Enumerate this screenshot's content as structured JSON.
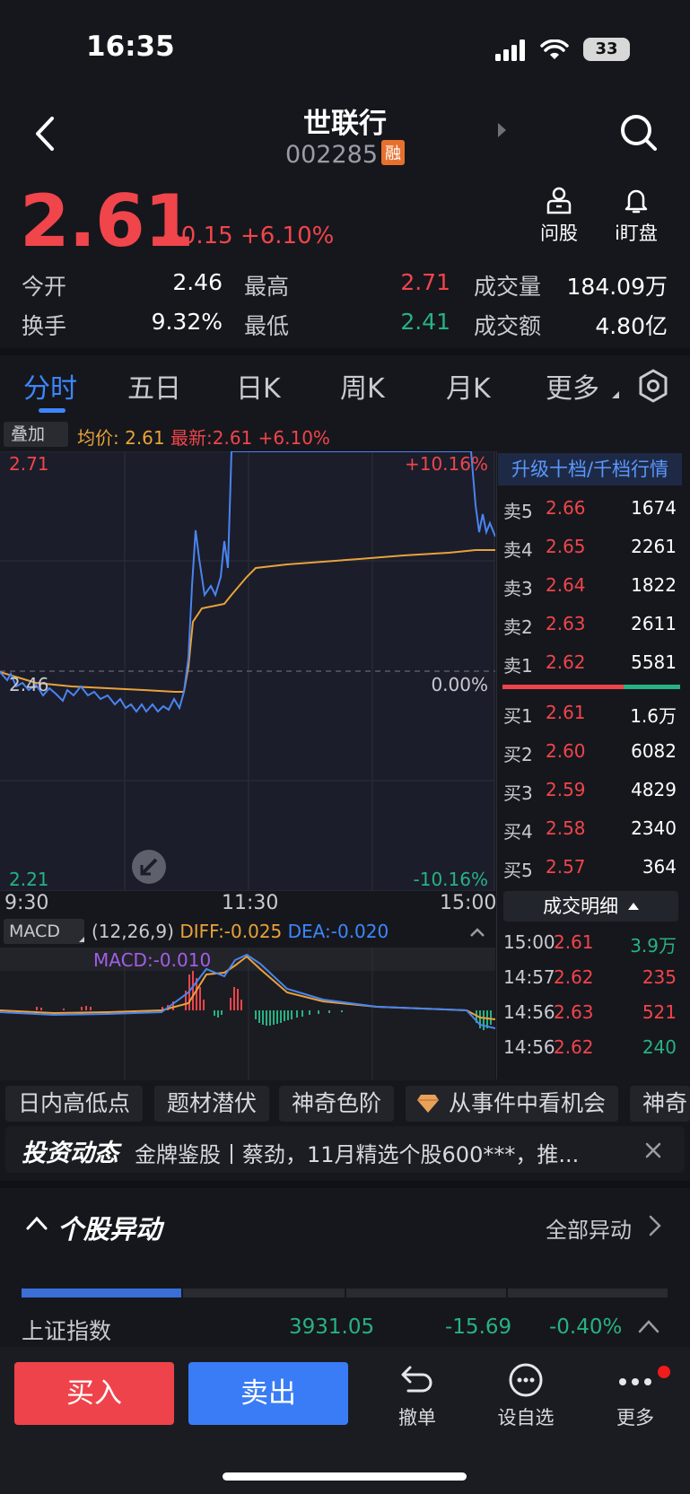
{
  "status": {
    "time": "16:35",
    "battery": "33"
  },
  "header": {
    "name": "世联行",
    "code": "002285",
    "badge": "融"
  },
  "quote": {
    "price": "2.61",
    "change": "+0.15",
    "change_pct": "+6.10%",
    "tools": [
      {
        "label": "问股"
      },
      {
        "label": "i盯盘"
      }
    ],
    "stats": [
      {
        "label": "今开",
        "value": "2.46"
      },
      {
        "label": "最高",
        "value": "2.71"
      },
      {
        "label": "成交量",
        "value": "184.09万"
      },
      {
        "label": "换手",
        "value": "9.32%"
      },
      {
        "label": "最低",
        "value": "2.41"
      },
      {
        "label": "成交额",
        "value": "4.80亿"
      }
    ]
  },
  "tabs": [
    "分时",
    "五日",
    "日K",
    "周K",
    "月K",
    "更多"
  ],
  "chart": {
    "overlay_label": "叠加",
    "avg_label": "均价: 2.61",
    "latest_label": "最新:2.61 +6.10%",
    "y_top": "2.71",
    "y_mid": "2.46",
    "y_bottom": "2.21",
    "pct_top": "+10.16%",
    "pct_mid": "0.00%",
    "pct_bottom": "-10.16%",
    "times": [
      "9:30",
      "11:30",
      "15:00"
    ],
    "macd": {
      "label": "MACD",
      "params": "(12,26,9)",
      "diff": "DIFF:-0.025",
      "dea": "DEA:-0.020",
      "macd": "MACD:-0.010"
    }
  },
  "orderbook": {
    "header": "升级十档/千档行情",
    "asks": [
      {
        "label": "卖5",
        "price": "2.66",
        "vol": "1674"
      },
      {
        "label": "卖4",
        "price": "2.65",
        "vol": "2261"
      },
      {
        "label": "卖3",
        "price": "2.64",
        "vol": "1822"
      },
      {
        "label": "卖2",
        "price": "2.63",
        "vol": "2611"
      },
      {
        "label": "卖1",
        "price": "2.62",
        "vol": "5581"
      }
    ],
    "bids": [
      {
        "label": "买1",
        "price": "2.61",
        "vol": "1.6万"
      },
      {
        "label": "买2",
        "price": "2.60",
        "vol": "6082"
      },
      {
        "label": "买3",
        "price": "2.59",
        "vol": "4829"
      },
      {
        "label": "买4",
        "price": "2.58",
        "vol": "2340"
      },
      {
        "label": "买5",
        "price": "2.57",
        "vol": "364"
      }
    ],
    "detail_label": "成交明细",
    "trades": [
      {
        "time": "15:00",
        "price": "2.61",
        "vol": "3.9万"
      },
      {
        "time": "14:57",
        "price": "2.62",
        "vol": "235"
      },
      {
        "time": "14:56",
        "price": "2.63",
        "vol": "521"
      },
      {
        "time": "14:56",
        "price": "2.62",
        "vol": "240"
      }
    ]
  },
  "chips": [
    "日内高低点",
    "题材潜伏",
    "神奇色阶",
    "从事件中看机会",
    "神奇"
  ],
  "news": {
    "title": "投资动态",
    "text": "金牌鉴股丨蔡劲，11月精选个股600***，推..."
  },
  "abnormal": {
    "title": "个股异动",
    "all_label": "全部异动"
  },
  "index": {
    "name": "上证指数",
    "value": "3931.05",
    "change": "-15.69",
    "pct": "-0.40%"
  },
  "bottom": {
    "buy": "买入",
    "sell": "卖出",
    "tools": [
      "撤单",
      "设自选",
      "更多"
    ]
  },
  "colors": {
    "up": "#f0454b",
    "down": "#27b282",
    "accent": "#3d86ff",
    "avg_line": "#e9a23b"
  }
}
